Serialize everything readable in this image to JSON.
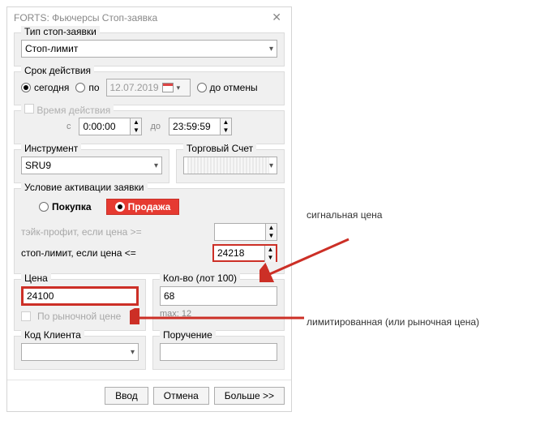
{
  "title": "FORTS: Фьючерсы Стоп-заявка",
  "groups": {
    "orderType": {
      "label": "Тип стоп-заявки",
      "value": "Стоп-лимит"
    },
    "validity": {
      "label": "Срок действия",
      "today": "сегодня",
      "until": "по",
      "date": "12.07.2019",
      "gtc": "до отмены",
      "selected": "today"
    },
    "timeRange": {
      "label": "Время действия",
      "from_lbl": "с",
      "from": "0:00:00",
      "to_lbl": "до",
      "to": "23:59:59"
    },
    "instrument": {
      "label": "Инструмент",
      "value": "SRU9"
    },
    "account": {
      "label": "Торговый Счет",
      "value": ""
    },
    "activation": {
      "label": "Условие активации заявки",
      "buy": "Покупка",
      "sell": "Продажа",
      "selected": "sell",
      "takeProfit": {
        "label": "тэйк-профит, если цена >=",
        "value": ""
      },
      "stopLimit": {
        "label": "стоп-лимит, если цена <=",
        "value": "24218"
      }
    },
    "price": {
      "label": "Цена",
      "value": "24100",
      "marketCheckbox": "По рыночной цене"
    },
    "qty": {
      "label": "Кол-во (лот 100)",
      "value": "68",
      "max": "max: 12"
    },
    "clientCode": {
      "label": "Код Клиента",
      "value": ""
    },
    "orderRef": {
      "label": "Поручение",
      "value": ""
    }
  },
  "buttons": {
    "enter": "Ввод",
    "cancel": "Отмена",
    "more": "Больше >>"
  },
  "annotations": {
    "signal": "сигнальная цена",
    "limit": "лимитированная (или рыночная цена)"
  }
}
